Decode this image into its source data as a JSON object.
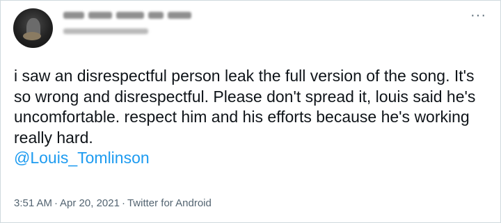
{
  "tweet": {
    "text": "i saw an disrespectful person leak the full version of the song. It's so wrong and disrespectful. Please don't spread it, louis said he's uncomfortable. respect him and his efforts because he's working really hard.",
    "mention": "@Louis_Tomlinson",
    "time": "3:51 AM",
    "date": "Apr 20, 2021",
    "source": "Twitter for Android",
    "separator": "·"
  },
  "header": {
    "more_icon": "···"
  },
  "colors": {
    "link": "#1d9bf0",
    "secondary_text": "#536471",
    "border": "#cfd9de"
  }
}
